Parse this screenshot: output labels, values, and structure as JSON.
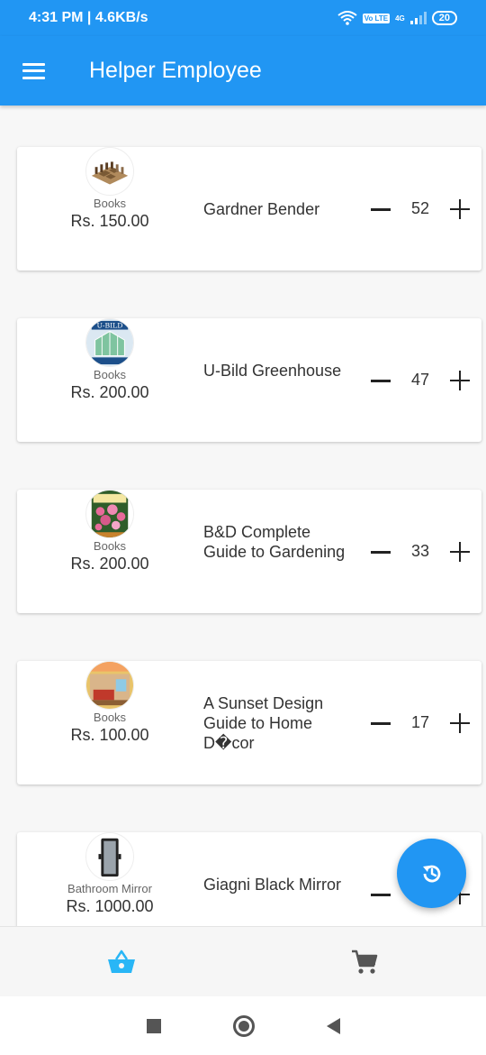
{
  "status_bar": {
    "time": "4:31 PM | 4.6KB/s",
    "network": "4G",
    "volte": "Vo LTE",
    "battery": "20"
  },
  "app_bar": {
    "title": "Helper Employee",
    "menu_icon": "hamburger-menu-icon"
  },
  "products": [
    {
      "category": "Books",
      "price": "Rs. 150.00",
      "name": "Gardner Bender",
      "qty": "52",
      "thumb": "chess-set"
    },
    {
      "category": "Books",
      "price": "Rs. 200.00",
      "name": "U-Bild Greenhouse",
      "qty": "47",
      "thumb": "greenhouse-book"
    },
    {
      "category": "Books",
      "price": "Rs. 200.00",
      "name": "B&D Complete Guide to Gardening",
      "qty": "33",
      "thumb": "gardening-book"
    },
    {
      "category": "Books",
      "price": "Rs. 100.00",
      "name": "A Sunset Design Guide to Home D�cor",
      "qty": "17",
      "thumb": "home-decor-book"
    },
    {
      "category": "Bathroom Mirror",
      "price": "Rs. 1000.00",
      "name": "Giagni Black Mirror",
      "qty": "",
      "thumb": "mirror"
    }
  ],
  "fab": {
    "icon": "refresh-history-icon"
  },
  "bottom_nav": {
    "items": [
      {
        "icon": "basket-icon",
        "active": true
      },
      {
        "icon": "cart-icon",
        "active": false
      }
    ]
  },
  "colors": {
    "primary": "#2196f3",
    "active_nav": "#29b6f6",
    "inactive_nav": "#555555"
  }
}
